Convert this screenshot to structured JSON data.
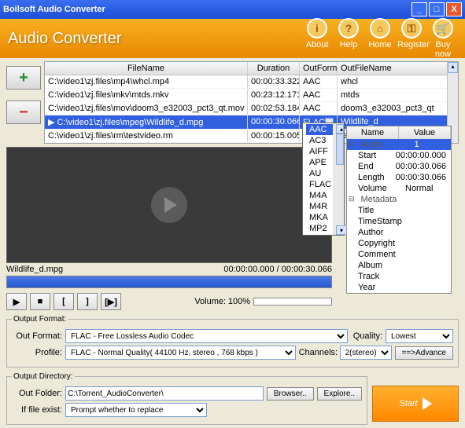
{
  "window": {
    "title": "Boilsoft Audio Converter"
  },
  "header": {
    "app_title": "Audio Converter",
    "buttons": {
      "about": "About",
      "help": "Help",
      "home": "Home",
      "register": "Register",
      "buy": "Buy now"
    }
  },
  "filelist": {
    "columns": {
      "name": "FileName",
      "duration": "Duration",
      "outformat": "OutFormat",
      "outfilename": "OutFileName"
    },
    "rows": [
      {
        "name": "C:\\video1\\zj.files\\mp4\\whcl.mp4",
        "dur": "00:00:33.322",
        "fmt": "AAC",
        "ofn": "whcl"
      },
      {
        "name": "C:\\video1\\zj.files\\mkv\\mtds.mkv",
        "dur": "00:23:12.171",
        "fmt": "AAC",
        "ofn": "mtds"
      },
      {
        "name": "C:\\video1\\zj.files\\mov\\doom3_e32003_pct3_qt.mov",
        "dur": "00:02:53.184",
        "fmt": "AAC",
        "ofn": "doom3_e32003_pct3_qt"
      },
      {
        "name": "C:\\video1\\zj.files\\mpeg\\Wildlife_d.mpg",
        "dur": "00:00:30.066",
        "fmt": "FLAC",
        "ofn": "Wildlife_d",
        "selected": true
      },
      {
        "name": "C:\\video1\\zj.files\\rm\\testvideo.rm",
        "dur": "00:00:15.005",
        "fmt": "AAC",
        "ofn": "testvideo"
      }
    ]
  },
  "format_dropdown": {
    "options": [
      "AAC",
      "AC3",
      "AIFF",
      "APE",
      "AU",
      "FLAC",
      "M4A",
      "M4R",
      "MKA",
      "MP2"
    ],
    "selected": "AAC"
  },
  "properties": {
    "columns": {
      "name": "Name",
      "value": "Value"
    },
    "audio_group": "Audio",
    "audio_value": "1",
    "rows": [
      {
        "name": "Start",
        "value": "00:00:00.000"
      },
      {
        "name": "End",
        "value": "00:00:30.066"
      },
      {
        "name": "Length",
        "value": "00:00:30.066"
      },
      {
        "name": "Volume",
        "value": "Normal"
      }
    ],
    "meta_group": "Metadata",
    "meta_rows": [
      "Title",
      "TimeStamp",
      "Author",
      "Copyright",
      "Comment",
      "Album",
      "Track",
      "Year"
    ]
  },
  "preview": {
    "filename": "Wildlife_d.mpg",
    "time": "00:00:00.000 / 00:00:30.066",
    "volume_label": "Volume:",
    "volume_value": "100%"
  },
  "output_format": {
    "legend": "Output Format:",
    "outformat_label": "Out Format:",
    "outformat_value": "FLAC - Free Lossless Audio Codec",
    "profile_label": "Profile:",
    "profile_value": "FLAC - Normal Quality( 44100 Hz, stereo , 768 kbps )",
    "quality_label": "Quality:",
    "quality_value": "Lowest",
    "channels_label": "Channels:",
    "channels_value": "2(stereo)",
    "advance": "==>Advance"
  },
  "output_dir": {
    "legend": "Output Directory:",
    "folder_label": "Out Folder:",
    "folder_value": "C:\\Torrent_AudioConverter\\",
    "browse": "Browser..",
    "explore": "Explore..",
    "exist_label": "If file exist:",
    "exist_value": "Prompt whether to replace"
  },
  "start": "Start"
}
